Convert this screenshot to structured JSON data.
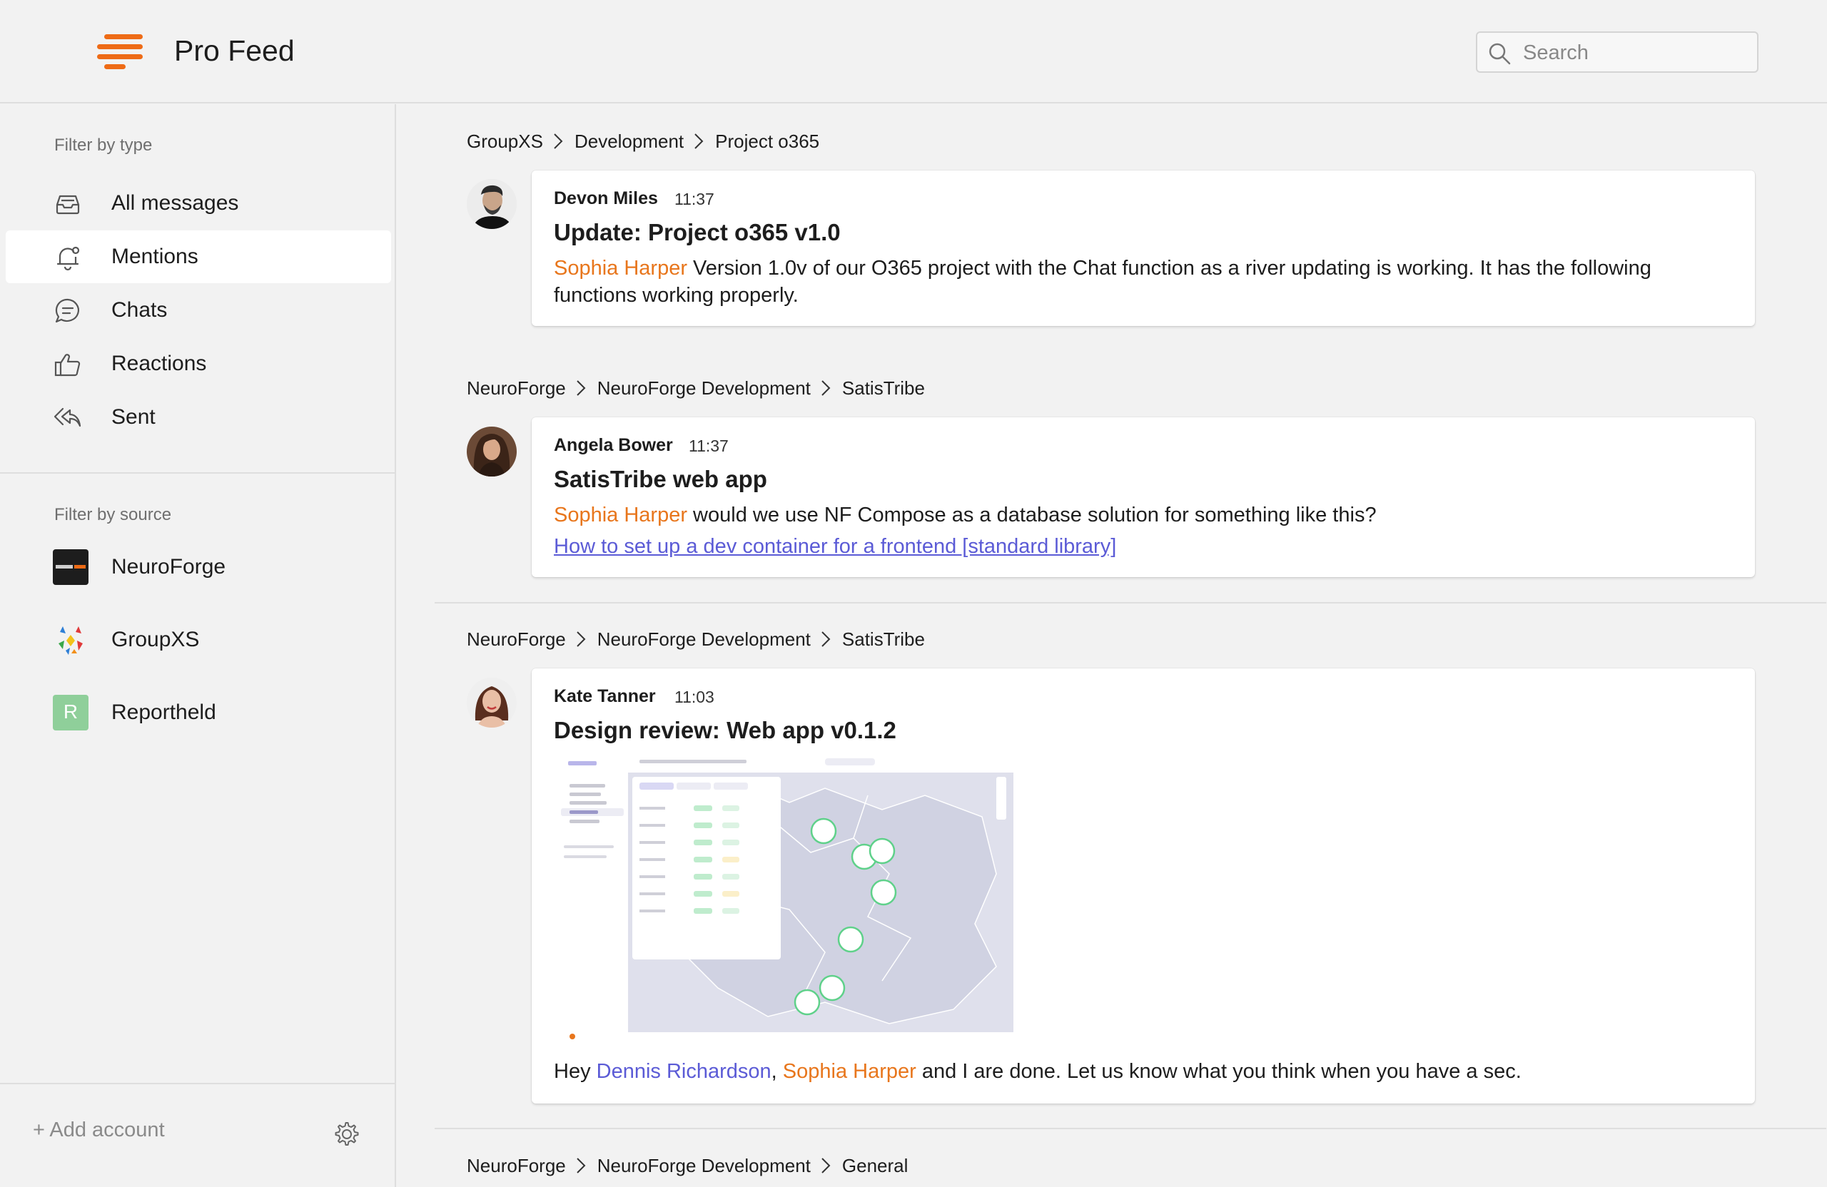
{
  "app": {
    "title": "Pro Feed"
  },
  "search": {
    "placeholder": "Search"
  },
  "sidebar": {
    "type_filter_label": "Filter by type",
    "type_items": [
      {
        "label": "All messages",
        "icon": "inbox-icon"
      },
      {
        "label": "Mentions",
        "icon": "bell-icon",
        "active": true
      },
      {
        "label": "Chats",
        "icon": "chat-bubble-icon"
      },
      {
        "label": "Reactions",
        "icon": "thumbs-up-icon"
      },
      {
        "label": "Sent",
        "icon": "reply-icon"
      }
    ],
    "source_filter_label": "Filter by source",
    "sources": [
      {
        "label": "NeuroForge",
        "logo_color": "#1d1d1d"
      },
      {
        "label": "GroupXS",
        "logo_color": "#f2f2f2"
      },
      {
        "label": "Reportheld",
        "logo_letter": "R",
        "logo_color": "#8fcf9a"
      }
    ],
    "add_account": "+ Add account"
  },
  "feed": {
    "posts": [
      {
        "breadcrumb": [
          "GroupXS",
          "Development",
          "Project o365"
        ],
        "author": "Devon Miles",
        "time": "11:37",
        "title": "Update: Project o365 v1.0",
        "mention": "Sophia Harper",
        "text": " Version 1.0v of our O365 project with the Chat function as a river updating is working. It has the following functions working properly."
      },
      {
        "breadcrumb": [
          "NeuroForge",
          "NeuroForge Development",
          "SatisTribe"
        ],
        "author": "Angela Bower",
        "time": "11:37",
        "title": "SatisTribe web app",
        "mention": "Sophia Harper",
        "text": " would we use NF Compose as a database solution for something like this?",
        "link": "How to set up a dev container for a frontend [standard library]"
      },
      {
        "breadcrumb": [
          "NeuroForge",
          "NeuroForge Development",
          "SatisTribe"
        ],
        "author": "Kate Tanner",
        "time": "11:03",
        "title": "Design review: Web app v0.1.2",
        "text_prefix": "Hey ",
        "mention_1": "Dennis Richardson",
        "comma": ", ",
        "mention_2": "Sophia Harper",
        "text_suffix": " and I are done. Let us know what you think when you have a sec."
      },
      {
        "breadcrumb": [
          "NeuroForge",
          "NeuroForge Development",
          "General"
        ]
      }
    ]
  },
  "colors": {
    "accent": "#ee6b16",
    "mention": "#e8761c",
    "link": "#5b5bd6"
  }
}
